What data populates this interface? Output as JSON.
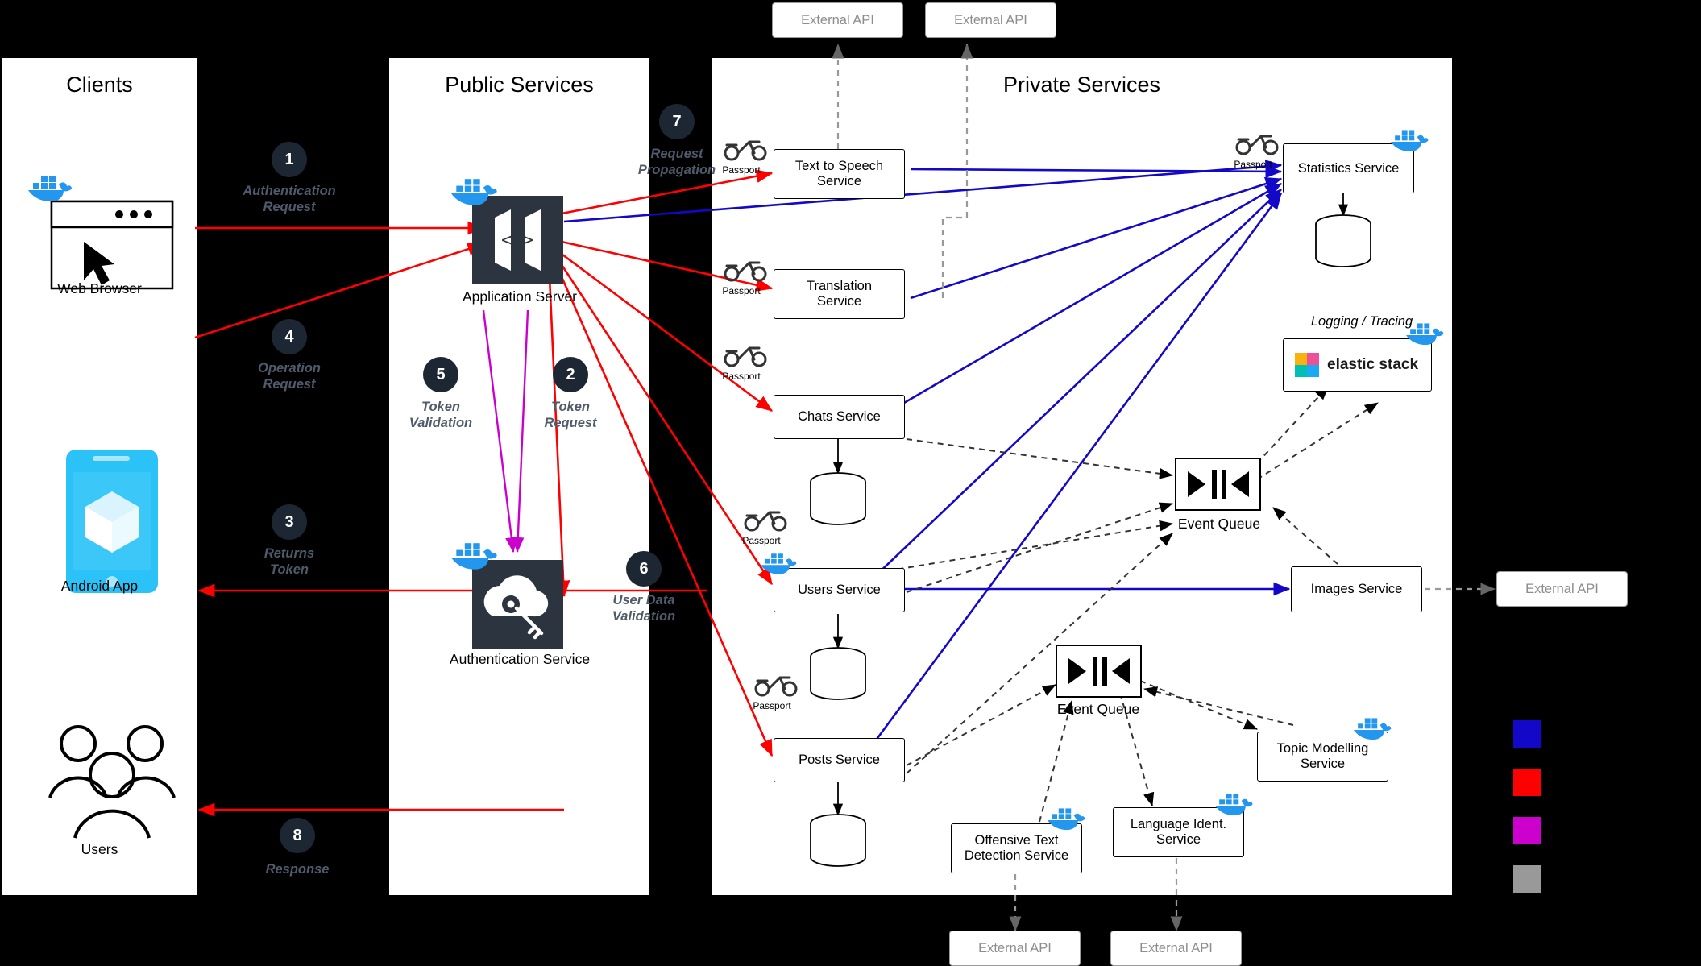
{
  "columns": [
    {
      "title": "Clients"
    },
    {
      "title": "Public Services"
    },
    {
      "title": "Private Services"
    }
  ],
  "clients": {
    "web_browser": "Web Browser",
    "android_app": "Android App",
    "users": "Users"
  },
  "public_services": {
    "application_server": "Application Server",
    "authentication_service": "Authentication Service"
  },
  "private_services": {
    "text_to_speech": "Text to Speech\nService",
    "text_to_speech_l1": "Text to Speech",
    "text_to_speech_l2": "Service",
    "translation_l1": "Translation",
    "translation_l2": "Service",
    "chats": "Chats Service",
    "users": "Users Service",
    "posts": "Posts Service",
    "statistics": "Statistics Service",
    "images": "Images Service",
    "topic_modelling_l1": "Topic Modelling",
    "topic_modelling_l2": "Service",
    "offensive_l1": "Offensive Text",
    "offensive_l2": "Detection Service",
    "language_l1": "Language Ident.",
    "language_l2": "Service",
    "event_queue_top": "Event Queue",
    "event_queue_bottom": "Event Queue",
    "logging_tracing": "Logging / Tracing",
    "elastic_stack": "elastic stack"
  },
  "external_apis": [
    "External API",
    "External API",
    "External API",
    "External API",
    "External API"
  ],
  "passport_label": "Passport",
  "steps": [
    {
      "n": "1",
      "label": "Authentication\nRequest",
      "l1": "Authentication",
      "l2": "Request"
    },
    {
      "n": "2",
      "label": "Token\nRequest",
      "l1": "Token",
      "l2": "Request"
    },
    {
      "n": "3",
      "label": "Returns\nToken",
      "l1": "Returns",
      "l2": "Token"
    },
    {
      "n": "4",
      "label": "Operation\nRequest",
      "l1": "Operation",
      "l2": "Request"
    },
    {
      "n": "5",
      "label": "Token\nValidation",
      "l1": "Token",
      "l2": "Validation"
    },
    {
      "n": "6",
      "label": "User Data\nValidation",
      "l1": "User Data",
      "l2": "Validation"
    },
    {
      "n": "7",
      "label": "Request\nPropagation",
      "l1": "Request",
      "l2": "Propagation"
    },
    {
      "n": "8",
      "label": "Response",
      "l1": "Response",
      "l2": ""
    }
  ],
  "legend": {
    "colors": [
      "#1408c8",
      "#fe0000",
      "#cc00cc",
      "#999999"
    ]
  },
  "colors": {
    "blue_arrow": "#1408c8",
    "red_arrow": "#fe0000",
    "magenta_arrow": "#cc00cc",
    "gray_dashed": "#666666",
    "badge_bg": "#1d2734",
    "docker_blue": "#2396ed",
    "android_blue": "#2bc3f7"
  }
}
